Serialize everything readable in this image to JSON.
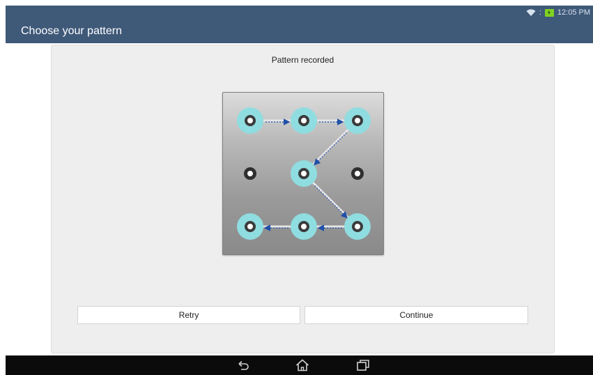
{
  "status_bar": {
    "time": "12:05 PM",
    "icons": [
      "wifi-icon",
      "battery-charging-icon"
    ]
  },
  "action_bar": {
    "title": "Choose your pattern"
  },
  "card": {
    "heading": "Pattern recorded"
  },
  "pattern": {
    "grid_size": 3,
    "selected_sequence": [
      1,
      2,
      3,
      5,
      9,
      8,
      7
    ],
    "unselected_dots": [
      4,
      6
    ],
    "ring_color": "#8fdde0",
    "line_color": "#e6e6e6",
    "arrow_color": "#1f4fa8"
  },
  "buttons": {
    "retry_label": "Retry",
    "continue_label": "Continue"
  },
  "nav_bar": {
    "icons": [
      "back-icon",
      "home-icon",
      "recent-apps-icon"
    ]
  },
  "colors": {
    "primary": "#3f5979",
    "nav_background": "#0b0b0b"
  }
}
